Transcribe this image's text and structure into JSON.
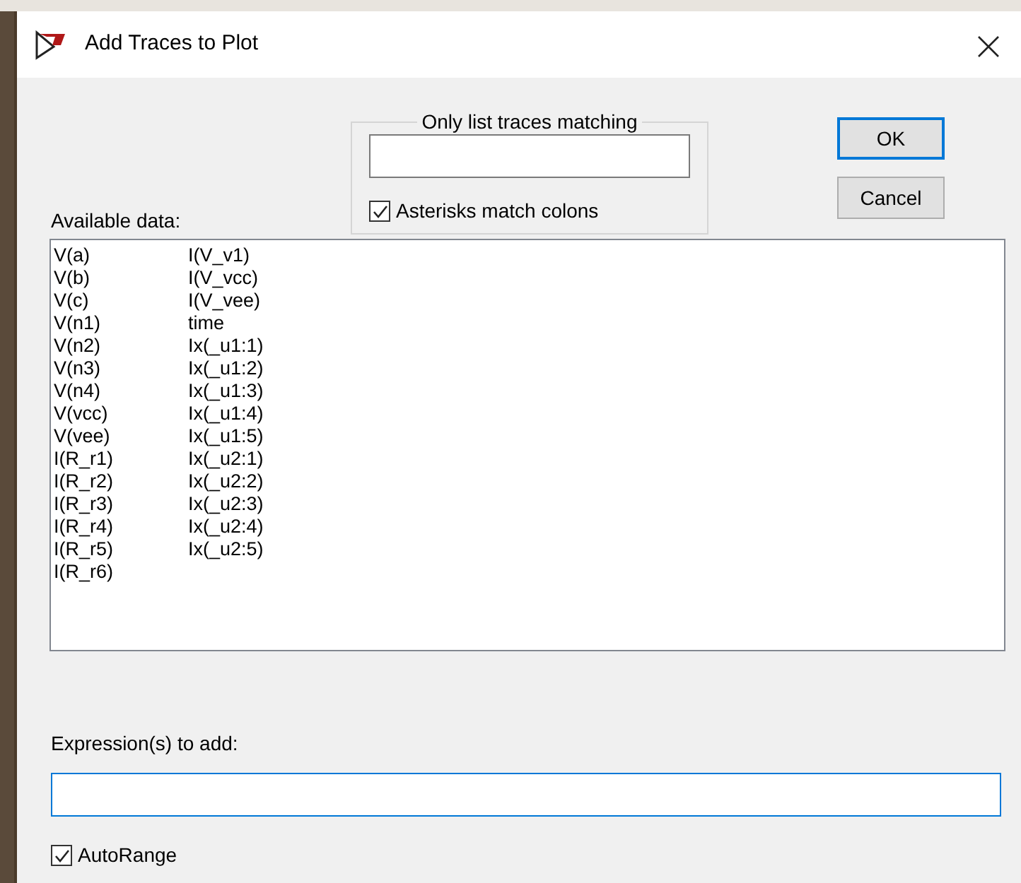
{
  "window": {
    "title": "Add Traces to Plot"
  },
  "filter": {
    "legend": "Only list traces matching",
    "asterisks": {
      "label": "Asterisks match colons",
      "checked": true
    }
  },
  "buttons": [
    {
      "label": "OK",
      "default": true
    },
    {
      "label": "Cancel",
      "default": false
    }
  ],
  "available": {
    "label": "Available data:",
    "items": [
      "V(a)",
      "V(b)",
      "V(c)",
      "V(n1)",
      "V(n2)",
      "V(n3)",
      "V(n4)",
      "V(vcc)",
      "V(vee)",
      "I(R_r1)",
      "I(R_r2)",
      "I(R_r3)",
      "I(R_r4)",
      "I(R_r5)",
      "I(R_r6)",
      "I(V_v1)",
      "I(V_vcc)",
      "I(V_vee)",
      "time",
      "Ix(_u1:1)",
      "Ix(_u1:2)",
      "Ix(_u1:3)",
      "Ix(_u1:4)",
      "Ix(_u1:5)",
      "Ix(_u2:1)",
      "Ix(_u2:2)",
      "Ix(_u2:3)",
      "Ix(_u2:4)",
      "Ix(_u2:5)"
    ]
  },
  "expression": {
    "label": "Expression(s) to add:"
  },
  "autorange": {
    "label": "AutoRange",
    "checked": true
  }
}
